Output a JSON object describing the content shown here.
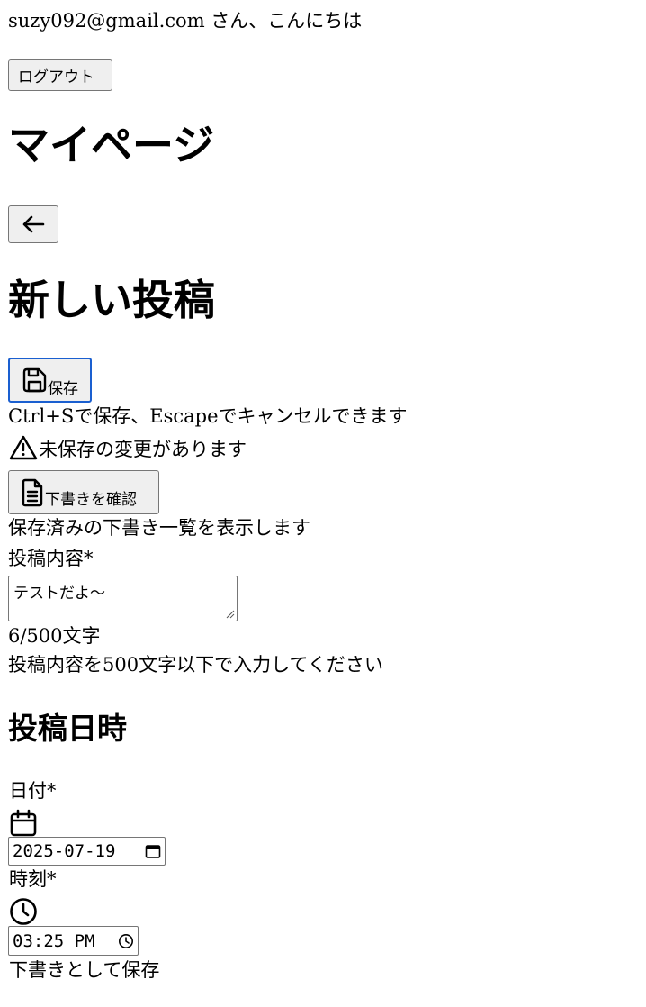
{
  "header": {
    "greeting": "suzy092@gmail.com さん、こんにちは",
    "logout_label": "ログアウト"
  },
  "page_title": "マイページ",
  "back_button": {
    "icon": "arrow-left-icon"
  },
  "form": {
    "title": "新しい投稿",
    "save_label": "保存",
    "save_icon": "floppy-disk-icon",
    "shortcut_hint": "Ctrl+Sで保存、Escapeでキャンセルできます",
    "unsaved_warning": "未保存の変更があります",
    "warning_icon": "warning-triangle-icon",
    "drafts_label": "下書きを確認",
    "drafts_icon": "document-icon",
    "drafts_hint": "保存済みの下書き一覧を表示します",
    "content": {
      "label": "投稿内容",
      "required_mark": "*",
      "value": "テストだよ〜",
      "char_count": "6/500文字",
      "help": "投稿内容を500文字以下で入力してください"
    },
    "datetime": {
      "heading": "投稿日時",
      "date_label": "日付",
      "date_required": "*",
      "date_value": "2025-07-19",
      "date_icon": "calendar-icon",
      "time_label": "時刻",
      "time_required": "*",
      "time_value": "03:25 PM",
      "time_icon": "clock-icon"
    },
    "save_draft_label": "下書きとして保存"
  }
}
